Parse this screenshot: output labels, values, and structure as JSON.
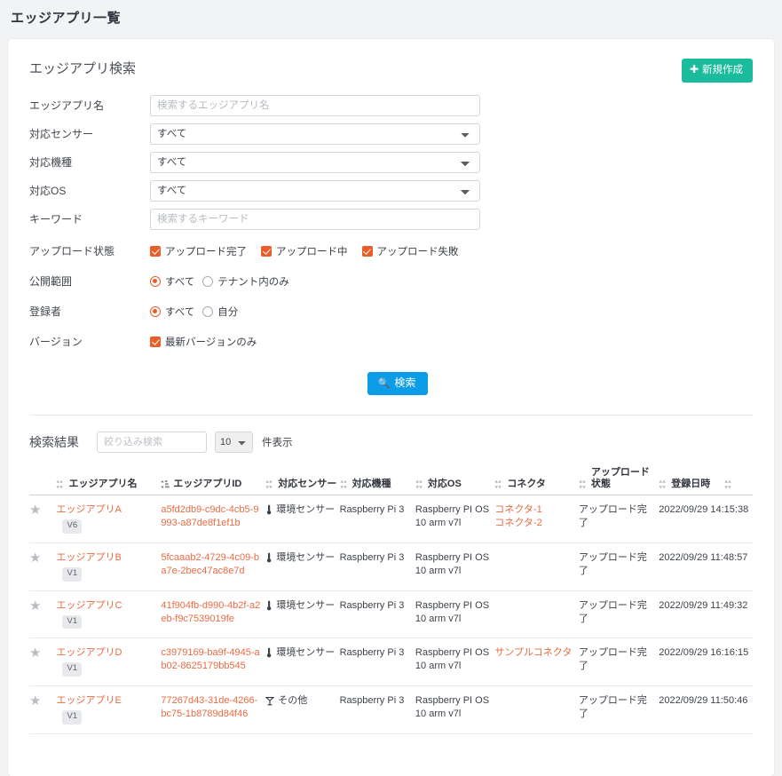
{
  "page": {
    "title": "エッジアプリ一覧"
  },
  "search_panel": {
    "title": "エッジアプリ検索",
    "new_button": {
      "label": "新規作成",
      "icon": "plus-icon",
      "color": "#1abc9c"
    },
    "fields": {
      "app_name": {
        "label": "エッジアプリ名",
        "placeholder": "検索するエッジアプリ名",
        "value": ""
      },
      "sensor": {
        "label": "対応センサー",
        "selected": "すべて"
      },
      "device": {
        "label": "対応機種",
        "selected": "すべて"
      },
      "os": {
        "label": "対応OS",
        "selected": "すべて"
      },
      "keyword": {
        "label": "キーワード",
        "placeholder": "検索するキーワード",
        "value": ""
      },
      "upload_state": {
        "label": "アップロード状態",
        "options": [
          {
            "label": "アップロード完了",
            "checked": true
          },
          {
            "label": "アップロード中",
            "checked": true
          },
          {
            "label": "アップロード失敗",
            "checked": true
          }
        ]
      },
      "scope": {
        "label": "公開範囲",
        "options": [
          {
            "label": "すべて",
            "selected": true
          },
          {
            "label": "テナント内のみ",
            "selected": false
          }
        ]
      },
      "registrant": {
        "label": "登録者",
        "options": [
          {
            "label": "すべて",
            "selected": true
          },
          {
            "label": "自分",
            "selected": false
          }
        ]
      },
      "version": {
        "label": "バージョン",
        "options": [
          {
            "label": "最新バージョンのみ",
            "checked": true
          }
        ]
      }
    },
    "search_button": {
      "label": "検索",
      "icon": "search-icon",
      "color": "#0d9de8"
    }
  },
  "results": {
    "title": "検索結果",
    "filter_placeholder": "絞り込み検索",
    "filter_value": "",
    "page_size": "10",
    "count_label": "件表示",
    "columns": [
      "エッジアプリ名",
      "エッジアプリID",
      "対応センサー",
      "対応機種",
      "対応OS",
      "コネクタ",
      "アップロード状態",
      "登録日時"
    ],
    "rows": [
      {
        "star": "★",
        "name": "エッジアプリA",
        "version": "V6",
        "id": "a5fd2db9-c9dc-4cb5-9993-a87de8f1ef1b",
        "sensor": "環境センサー",
        "sensor_icon": "thermometer-icon",
        "device": "Raspberry Pi 3",
        "os": "Raspberry PI OS 10 arm v7l",
        "connectors": [
          "コネクタ-1",
          "コネクタ-2"
        ],
        "upload_state": "アップロード完了",
        "registered_at": "2022/09/29 14:15:38"
      },
      {
        "star": "★",
        "name": "エッジアプリB",
        "version": "V1",
        "id": "5fcaaab2-4729-4c09-ba7e-2bec47ac8e7d",
        "sensor": "環境センサー",
        "sensor_icon": "thermometer-icon",
        "device": "Raspberry Pi 3",
        "os": "Raspberry PI OS 10 arm v7l",
        "connectors": [],
        "upload_state": "アップロード完了",
        "registered_at": "2022/09/29 11:48:57"
      },
      {
        "star": "★",
        "name": "エッジアプリC",
        "version": "V1",
        "id": "41f904fb-d990-4b2f-a2eb-f9c7539019fe",
        "sensor": "環境センサー",
        "sensor_icon": "thermometer-icon",
        "device": "Raspberry Pi 3",
        "os": "Raspberry PI OS 10 arm v7l",
        "connectors": [],
        "upload_state": "アップロード完了",
        "registered_at": "2022/09/29 11:49:32"
      },
      {
        "star": "★",
        "name": "エッジアプリD",
        "version": "V1",
        "id": "c3979169-ba9f-4945-ab02-8625179bb545",
        "sensor": "環境センサー",
        "sensor_icon": "thermometer-icon",
        "device": "Raspberry Pi 3",
        "os": "Raspberry PI OS 10 arm v7l",
        "connectors": [
          "サンプルコネクタ"
        ],
        "upload_state": "アップロード完了",
        "registered_at": "2022/09/29 16:16:15"
      },
      {
        "star": "★",
        "name": "エッジアプリE",
        "version": "V1",
        "id": "77267d43-31de-4266-bc75-1b8789d84f46",
        "sensor": "その他",
        "sensor_icon": "antenna-icon",
        "device": "Raspberry Pi 3",
        "os": "Raspberry PI OS 10 arm v7l",
        "connectors": [],
        "upload_state": "アップロード完了",
        "registered_at": "2022/09/29 11:50:46"
      }
    ]
  },
  "colors": {
    "accent_link": "#ea6b43",
    "check_accent": "#ea5c28",
    "primary_button": "#0d9de8",
    "create_button": "#1abc9c",
    "page_bg": "#f2f3f5"
  }
}
